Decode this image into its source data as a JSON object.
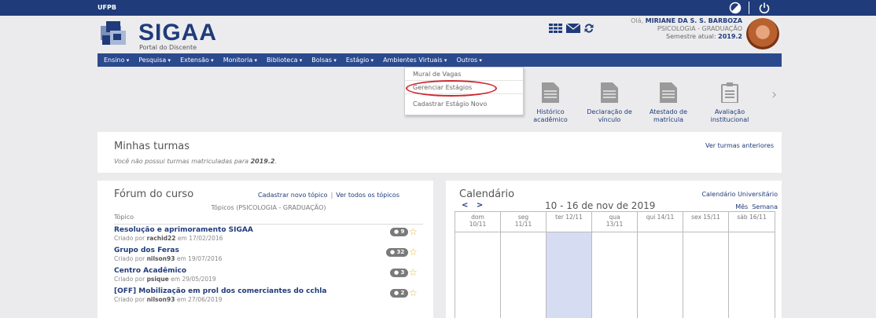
{
  "topbar": {
    "institution": "UFPB",
    "icons": [
      "contrast-icon",
      "power-icon"
    ]
  },
  "header": {
    "title": "SIGAA",
    "subtitle": "Portal do Discente",
    "icons": [
      "apps-grid-icon",
      "mail-icon",
      "refresh-icon"
    ],
    "greeting": "Olá,",
    "user_name": "MIRIANE DA S. S. BARBOZA",
    "course": "PSICOLOGIA - GRADUAÇÃO",
    "semester_label": "Semestre atual:",
    "semester": "2019.2"
  },
  "menu": {
    "items": [
      "Ensino",
      "Pesquisa",
      "Extensão",
      "Monitoria",
      "Biblioteca",
      "Bolsas",
      "Estágio",
      "Ambientes Virtuais",
      "Outros"
    ]
  },
  "dropdown": {
    "items": [
      "Mural de Vagas",
      "Gerenciar Estágios",
      "Cadastrar Estágio Novo"
    ],
    "highlighted": "Gerenciar Estágios",
    "highlight_color": "#d0262d"
  },
  "shortcuts": [
    {
      "line1": "Histórico",
      "line2": "acadêmico",
      "icon": "document-icon"
    },
    {
      "line1": "Declaração de",
      "line2": "vínculo",
      "icon": "document-icon"
    },
    {
      "line1": "Atestado de",
      "line2": "matrícula",
      "icon": "document-icon"
    },
    {
      "line1": "Avaliação",
      "line2": "institucional",
      "icon": "clipboard-icon"
    }
  ],
  "turmas": {
    "title": "Minhas turmas",
    "prev_link": "Ver turmas anteriores",
    "empty_text": "Você não possui turmas matriculadas para",
    "empty_period": "2019.2"
  },
  "forum": {
    "title": "Fórum do curso",
    "new_topic": "Cadastrar novo tópico",
    "separator": "|",
    "view_all": "Ver todos os tópicos",
    "subtitle": "Tópicos (PSICOLOGIA - GRADUAÇÃO)",
    "column": "Tópico",
    "created_by": "Criado por",
    "on": "em",
    "topics": [
      {
        "title": "Resolução e aprimoramento SIGAA",
        "author": "rachid22",
        "date": "17/02/2016",
        "count": "9"
      },
      {
        "title": "Grupo dos Feras",
        "author": "nilson93",
        "date": "19/07/2016",
        "count": "32"
      },
      {
        "title": "Centro Acadêmico",
        "author": "psique",
        "date": "29/05/2019",
        "count": "3"
      },
      {
        "title": "[OFF] Mobilização em prol dos comerciantes do cchla",
        "author": "nilson93",
        "date": "27/06/2019",
        "count": "2"
      }
    ]
  },
  "calendar": {
    "title": "Calendário",
    "univ_link": "Calendário Universitário",
    "nav_prev": "<",
    "nav_next": ">",
    "range": "10 - 16 de nov de 2019",
    "view_month": "Mês",
    "view_week": "Semana",
    "days": [
      {
        "line1": "dom",
        "line2": "10/11"
      },
      {
        "line1": "seg",
        "line2": "11/11"
      },
      {
        "line1": "ter 12/11",
        "line2": ""
      },
      {
        "line1": "qua",
        "line2": "13/11"
      },
      {
        "line1": "qui 14/11",
        "line2": ""
      },
      {
        "line1": "sex 15/11",
        "line2": ""
      },
      {
        "line1": "sáb 16/11",
        "line2": ""
      }
    ],
    "today_index": 2,
    "today_color": "#d6dcf1"
  },
  "colors": {
    "primary": "#1f3b7a",
    "menu": "#2b4a8e",
    "background": "#ebebed"
  }
}
